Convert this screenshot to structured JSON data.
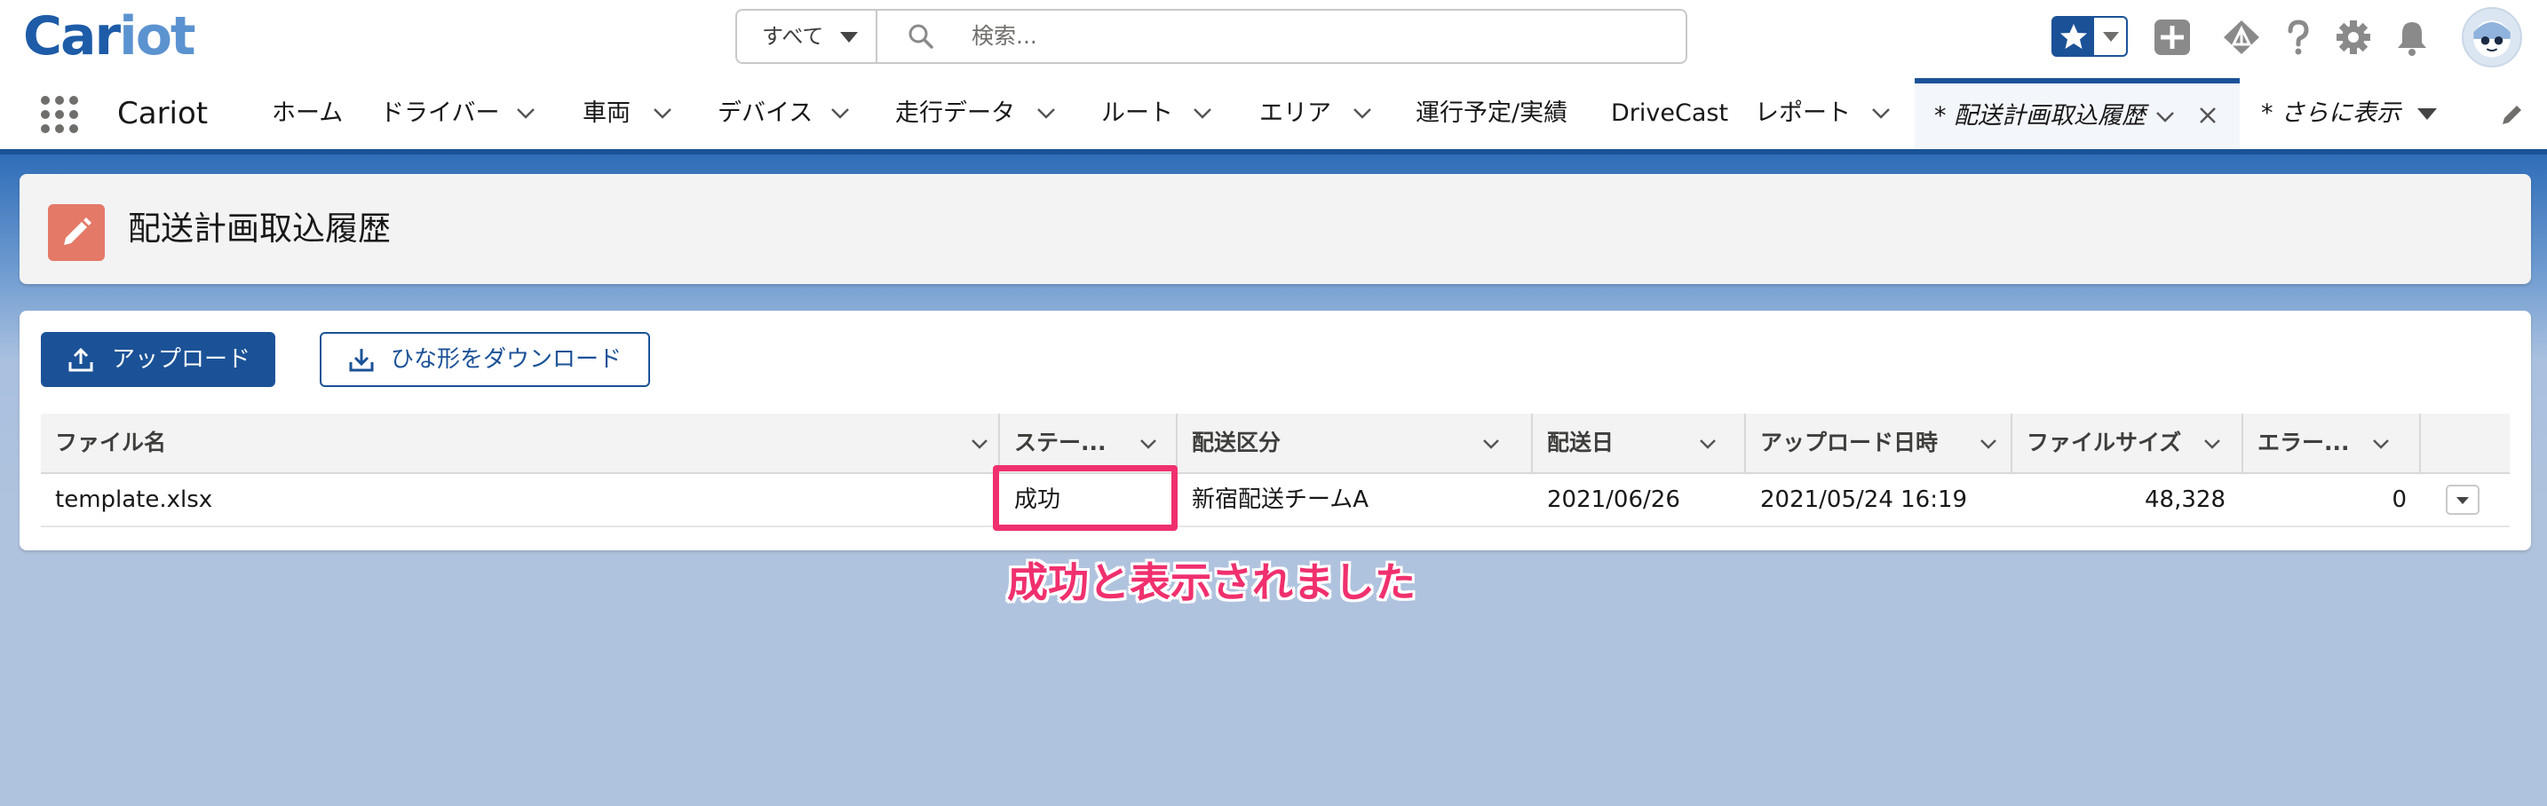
{
  "app": {
    "logo_main": "Car",
    "logo_rest": "iot",
    "name": "Cariot"
  },
  "search": {
    "scope": "すべて",
    "placeholder": "検索..."
  },
  "header_icons": [
    "star-icon",
    "add-icon",
    "trailhead-icon",
    "help-icon",
    "setup-gear-icon",
    "bell-icon",
    "avatar"
  ],
  "nav": {
    "items": [
      {
        "label": "ホーム"
      },
      {
        "label": "ドライバー"
      },
      {
        "label": "車両"
      },
      {
        "label": "デバイス"
      },
      {
        "label": "走行データ"
      },
      {
        "label": "ルート"
      },
      {
        "label": "エリア"
      },
      {
        "label": "運行予定/実績"
      },
      {
        "label": "DriveCast"
      },
      {
        "label": "レポート"
      }
    ],
    "active_tab": "* 配送計画取込履歴",
    "more": "* さらに表示"
  },
  "page": {
    "title": "配送計画取込履歴"
  },
  "actions": {
    "upload": "アップロード",
    "download": "ひな形をダウンロード"
  },
  "table": {
    "headers": [
      "ファイル名",
      "ステー...",
      "配送区分",
      "配送日",
      "アップロード日時",
      "ファイルサイズ",
      "エラー..."
    ],
    "rows": [
      [
        "template.xlsx",
        "成功",
        "新宿配送チームA",
        "2021/06/26",
        "2021/05/24 16:19",
        "48,328",
        "0"
      ]
    ]
  },
  "annotation": {
    "text": "成功と表示されました"
  },
  "colors": {
    "brand": "#1b5297",
    "highlight": "#f0306e",
    "page_icon": "#e47967"
  }
}
